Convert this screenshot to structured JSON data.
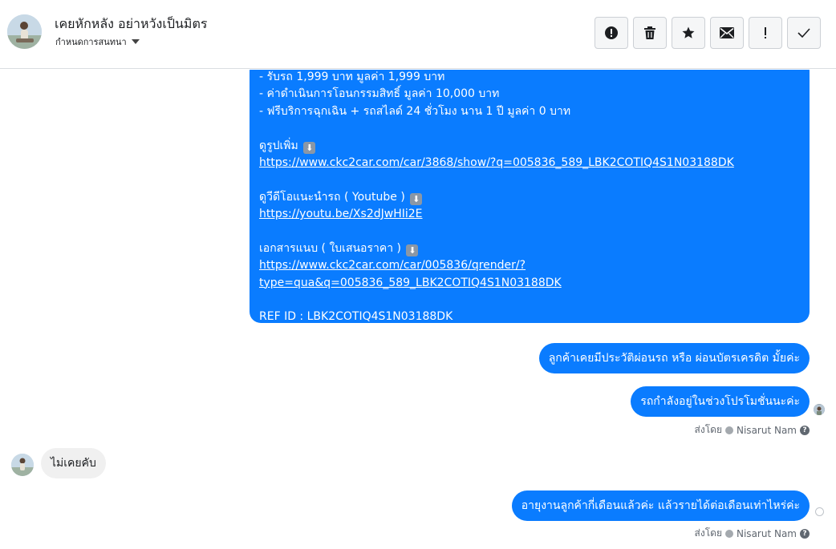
{
  "header": {
    "contact_name": "เคยหักหลัง อย่าหวังเป็นมิตร",
    "assign_label": "กำหนดการสนทนา",
    "actions": [
      {
        "name": "spam-button",
        "icon": "alert-circle-icon"
      },
      {
        "name": "delete-button",
        "icon": "trash-icon"
      },
      {
        "name": "star-button",
        "icon": "star-icon"
      },
      {
        "name": "mark-unread-button",
        "icon": "envelope-icon"
      },
      {
        "name": "follow-up-button",
        "icon": "exclamation-icon"
      },
      {
        "name": "mark-done-button",
        "icon": "checkmark-icon"
      }
    ]
  },
  "messages": {
    "offer": {
      "line1": "- รับรถ 1,999 บาท     มูลค่า 1,999 บาท",
      "line2": "- ค่าดำเนินการโอนกรรมสิทธิ์     มูลค่า 10,000 บาท",
      "line3": "- ฟรีบริการฉุกเฉิน + รถสไลด์ 24 ชั่วโมง นาน 1 ปี     มูลค่า 0 บาท",
      "photos_label": "ดูรูปเพิ่ม",
      "photos_link": "https://www.ckc2car.com/car/3868/show/?q=005836_589_LBK2COTIQ4S1N03188DK",
      "video_label": "ดูวีดีโอแนะนำรถ ( Youtube )",
      "video_link": "https://youtu.be/Xs2dJwHIi2E",
      "doc_label": "เอกสารแนบ ( ใบเสนอราคา )",
      "doc_link_1": "https://www.ckc2car.com/car/005836/qrender/?",
      "doc_link_2": "type=qua&q=005836_589_LBK2COTIQ4S1N03188DK",
      "ref": "REF ID : LBK2COTIQ4S1N03188DK"
    },
    "out1": "ลูกค้าเคยมีประวัติผ่อนรถ หรือ ผ่อนบัตรเครดิต มั้ยค่ะ",
    "out2": "รถกำลังอยู่ในช่วงโปรโมชั่นนะค่ะ",
    "sent_by_1": {
      "prefix": "ส่งโดย",
      "name": "Nisarut Nam"
    },
    "in1": "ไม่เคยคับ",
    "out3": "อายุงานลูกค้ากี่เดือนแล้วค่ะ แล้วรายได้ต่อเดือนเท่าไหร่ค่ะ",
    "sent_by_2": {
      "prefix": "ส่งโดย",
      "name": "Nisarut Nam"
    }
  },
  "colors": {
    "outgoing_bubble": "#0a7cff",
    "incoming_bubble": "#f0f0f0",
    "divider": "#dadde1"
  }
}
